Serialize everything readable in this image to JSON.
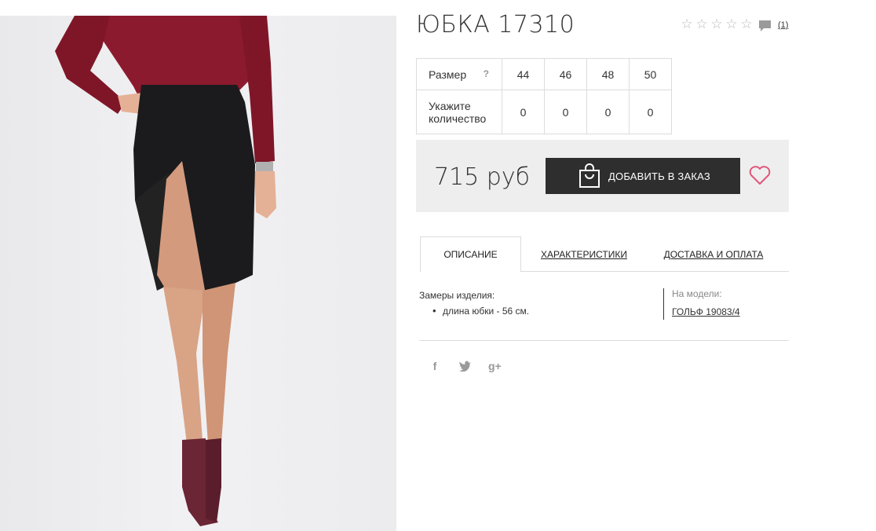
{
  "product": {
    "title": "ЮБКА 17310",
    "rating_stars": [
      "☆",
      "☆",
      "☆",
      "☆",
      "☆"
    ],
    "comments_count": "(1)"
  },
  "sizes": {
    "size_label": "Размер",
    "help_mark": "?",
    "qty_label": "Укажите количество",
    "values": [
      "44",
      "46",
      "48",
      "50"
    ],
    "quantities": [
      "0",
      "0",
      "0",
      "0"
    ]
  },
  "purchase": {
    "price": "715 руб",
    "order_button": "ДОБАВИТЬ В ЗАКАЗ",
    "icons": {
      "bag": "shopping-bag-icon",
      "wishlist": "heart-icon"
    }
  },
  "tabs": [
    {
      "label": "ОПИСАНИЕ",
      "active": true
    },
    {
      "label": "ХАРАКТЕРИСТИКИ",
      "active": false
    },
    {
      "label": "ДОСТАВКА И ОПЛАТА",
      "active": false
    }
  ],
  "description": {
    "measurements_title": "Замеры изделия:",
    "items": [
      "длина юбки - 56 см."
    ],
    "model_label": "На модели:",
    "model_link": "ГОЛЬФ 19083/4"
  },
  "social": {
    "facebook": "f",
    "twitter": "🐦",
    "google_plus": "g+"
  },
  "colors": {
    "button_bg": "#2e2e2e",
    "buy_box_bg": "#eeeeef",
    "heart": "#e0577a",
    "sweater": "#8c1a2e",
    "skirt": "#1b1b1d"
  }
}
